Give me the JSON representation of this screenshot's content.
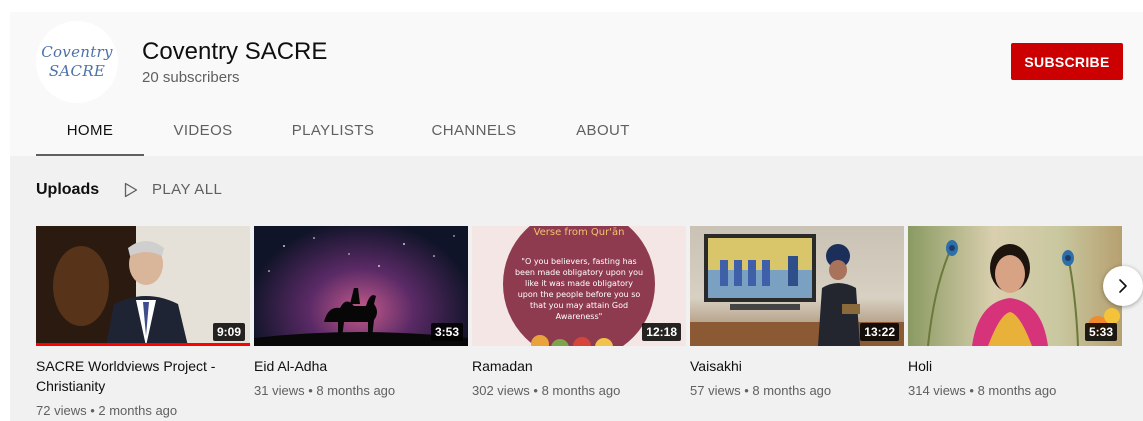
{
  "channel": {
    "avatar_line1": "Coventry",
    "avatar_line2": "SACRE",
    "name": "Coventry SACRE",
    "subscribers": "20 subscribers",
    "subscribe_label": "SUBSCRIBE",
    "subscribe_color": "#cc0000"
  },
  "tabs": [
    {
      "label": "HOME",
      "active": true
    },
    {
      "label": "VIDEOS",
      "active": false
    },
    {
      "label": "PLAYLISTS",
      "active": false
    },
    {
      "label": "CHANNELS",
      "active": false
    },
    {
      "label": "ABOUT",
      "active": false
    }
  ],
  "uploads": {
    "title": "Uploads",
    "play_all": "PLAY ALL"
  },
  "videos": [
    {
      "title": "SACRE Worldviews Project - Christianity",
      "duration": "9:09",
      "meta": "72 views • 2 months ago",
      "watched_fraction": 1.0
    },
    {
      "title": "Eid Al-Adha",
      "duration": "3:53",
      "meta": "31 views • 8 months ago"
    },
    {
      "title": "Ramadan",
      "duration": "12:18",
      "meta": "302 views • 8 months ago",
      "thumb_heading": "Verse from Qur'ān",
      "thumb_quote": "\"O you believers, fasting has been made obligatory upon you like it was made obligatory upon the people before you so that you may attain God Awareness\""
    },
    {
      "title": "Vaisakhi",
      "duration": "13:22",
      "meta": "57 views • 8 months ago"
    },
    {
      "title": "Holi",
      "duration": "5:33",
      "meta": "314 views • 8 months ago"
    }
  ],
  "icons": {
    "play_all": "play-outline-icon",
    "next": "chevron-right-icon"
  }
}
